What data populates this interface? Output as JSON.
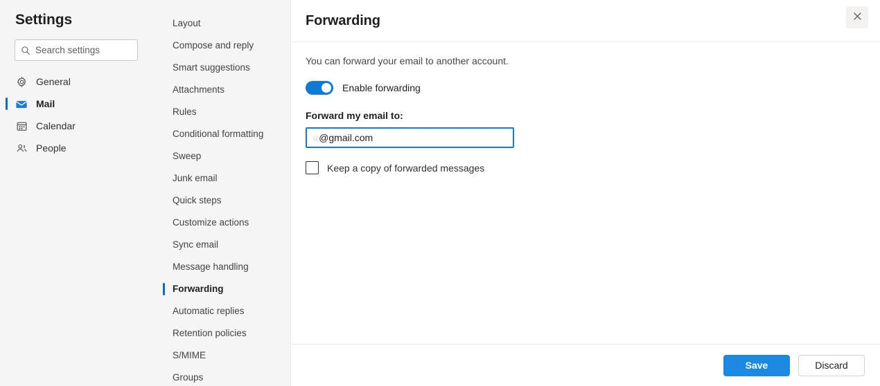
{
  "settings": {
    "title": "Settings",
    "search": {
      "placeholder": "Search settings",
      "value": "",
      "icon": "search-icon"
    },
    "categories": [
      {
        "label": "General",
        "icon": "gear-icon",
        "selected": false
      },
      {
        "label": "Mail",
        "icon": "envelope-icon",
        "selected": true
      },
      {
        "label": "Calendar",
        "icon": "calendar-icon",
        "selected": false
      },
      {
        "label": "People",
        "icon": "people-icon",
        "selected": false
      }
    ]
  },
  "subnav": {
    "items": [
      {
        "label": "Layout",
        "selected": false
      },
      {
        "label": "Compose and reply",
        "selected": false
      },
      {
        "label": "Smart suggestions",
        "selected": false
      },
      {
        "label": "Attachments",
        "selected": false
      },
      {
        "label": "Rules",
        "selected": false
      },
      {
        "label": "Conditional formatting",
        "selected": false
      },
      {
        "label": "Sweep",
        "selected": false
      },
      {
        "label": "Junk email",
        "selected": false
      },
      {
        "label": "Quick steps",
        "selected": false
      },
      {
        "label": "Customize actions",
        "selected": false
      },
      {
        "label": "Sync email",
        "selected": false
      },
      {
        "label": "Message handling",
        "selected": false
      },
      {
        "label": "Forwarding",
        "selected": true
      },
      {
        "label": "Automatic replies",
        "selected": false
      },
      {
        "label": "Retention policies",
        "selected": false
      },
      {
        "label": "S/MIME",
        "selected": false
      },
      {
        "label": "Groups",
        "selected": false
      }
    ]
  },
  "content": {
    "title": "Forwarding",
    "close_icon": "close-icon",
    "description": "You can forward your email to another account.",
    "enable_toggle": {
      "label": "Enable forwarding",
      "state": "on"
    },
    "forward_field": {
      "label": "Forward my email to:",
      "value_obscured": "u",
      "value_domain": "@gmail.com",
      "focused": true
    },
    "keep_copy": {
      "label": "Keep a copy of forwarded messages",
      "checked": false
    },
    "footer": {
      "save_label": "Save",
      "discard_label": "Discard"
    }
  },
  "colors": {
    "accent": "#0f6cbd",
    "toggle_on": "#0f7bd4",
    "primary_button": "#1a8ae0",
    "pane_background": "#f5f5f5",
    "content_background": "#ffffff"
  }
}
